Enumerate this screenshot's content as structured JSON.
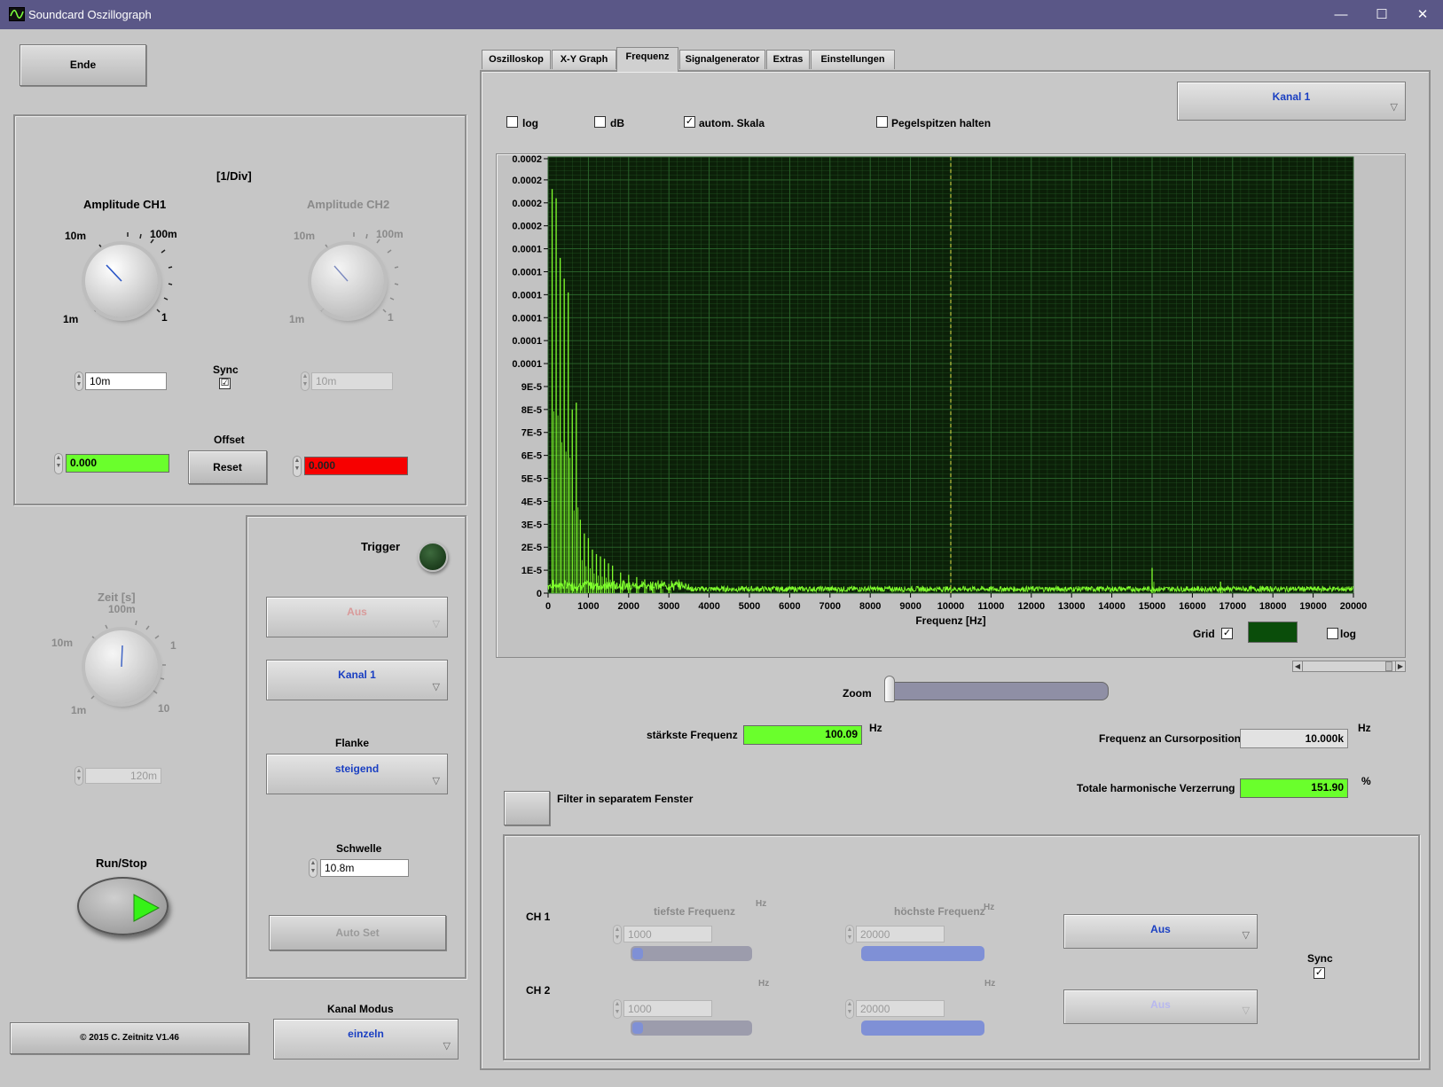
{
  "window": {
    "title": "Soundcard Oszillograph",
    "minimize": "—",
    "maximize": "☐",
    "close": "✕"
  },
  "left": {
    "ende_label": "Ende",
    "div_unit": "[1/Div]",
    "amp_ch1": {
      "label": "Amplitude CH1",
      "ticks": [
        "10m",
        "100m",
        "1m",
        "1"
      ],
      "value": "10m"
    },
    "amp_ch2": {
      "label": "Amplitude CH2",
      "ticks": [
        "10m",
        "100m",
        "1m",
        "1"
      ],
      "value": "10m"
    },
    "sync_label": "Sync",
    "sync_checked": "☑",
    "offset_label": "Offset",
    "offset_ch1": "0.000",
    "offset_reset": "Reset",
    "offset_ch2": "0.000",
    "zeit": {
      "label": "Zeit [s]",
      "ticks": [
        "100m",
        "10m",
        "1",
        "1m",
        "10"
      ],
      "value": "120m"
    },
    "runstop_label": "Run/Stop",
    "copyright": "© 2015  C. Zeitnitz V1.46",
    "kanal_modus_label": "Kanal Modus",
    "kanal_modus_value": "einzeln"
  },
  "trigger": {
    "label": "Trigger",
    "mode": "Aus",
    "channel": "Kanal 1",
    "flanke_label": "Flanke",
    "flanke_value": "steigend",
    "schwelle_label": "Schwelle",
    "schwelle_value": "10.8m",
    "autoset_label": "Auto Set"
  },
  "tabs": [
    {
      "label": "Oszilloskop"
    },
    {
      "label": "X-Y Graph"
    },
    {
      "label": "Frequenz"
    },
    {
      "label": "Signalgenerator"
    },
    {
      "label": "Extras"
    },
    {
      "label": "Einstellungen"
    }
  ],
  "freq": {
    "channel_select": "Kanal 1",
    "options": {
      "log": "log",
      "db": "dB",
      "autoscale": "autom. Skala",
      "peakhold": "Pegelspitzen halten"
    },
    "zoom_label": "Zoom",
    "strongest_label": "stärkste Frequenz",
    "strongest_value": "100.09",
    "strongest_unit": "Hz",
    "cursor_label": "Frequenz an Cursorposition",
    "cursor_value": "10.000k",
    "cursor_unit": "Hz",
    "thd_label": "Totale harmonische Verzerrung",
    "thd_value": "151.90",
    "thd_unit": "%",
    "filter_label": "Filter in separatem Fenster",
    "grid_label": "Grid",
    "log2_label": "log"
  },
  "filter": {
    "ch1": {
      "label": "CH 1",
      "low_label": "tiefste Frequenz",
      "low_unit": "Hz",
      "low_value": "1000",
      "high_label": "höchste Frequenz",
      "high_unit": "Hz",
      "high_value": "20000",
      "mode": "Aus"
    },
    "ch2": {
      "label": "CH 2",
      "low_unit": "Hz",
      "low_value": "1000",
      "high_unit": "Hz",
      "high_value": "20000",
      "mode": "Aus"
    },
    "sync_label": "Sync"
  },
  "colors": {
    "plot_bg": "#0b1f08",
    "grid": "#2f6d2f",
    "trace": "#80ff2e",
    "cursor": "#e6e64a",
    "accent": "#1a3fc2",
    "green_ind": "#6aff2c",
    "red_ind": "#f70000"
  },
  "chart_data": {
    "type": "line",
    "xlabel": "Frequenz [Hz]",
    "xlim": [
      0,
      20000
    ],
    "ylim": [
      0,
      0.00019
    ],
    "x_ticks": [
      "0",
      "1000",
      "2000",
      "3000",
      "4000",
      "5000",
      "6000",
      "7000",
      "8000",
      "9000",
      "10000",
      "11000",
      "12000",
      "13000",
      "14000",
      "15000",
      "16000",
      "17000",
      "18000",
      "19000",
      "20000"
    ],
    "y_ticks": [
      "0",
      "1E-5",
      "2E-5",
      "3E-5",
      "4E-5",
      "5E-5",
      "6E-5",
      "7E-5",
      "8E-5",
      "9E-5",
      "0.0001",
      "0.0001",
      "0.0001",
      "0.0001",
      "0.0001",
      "0.0001",
      "0.0002",
      "0.0002",
      "0.0002",
      "0.0002"
    ],
    "cursor_x": 10000,
    "peaks": [
      {
        "x": 100,
        "y": 0.000176
      },
      {
        "x": 200,
        "y": 0.000172
      },
      {
        "x": 300,
        "y": 0.000146
      },
      {
        "x": 400,
        "y": 0.000137
      },
      {
        "x": 500,
        "y": 0.000131
      },
      {
        "x": 600,
        "y": 8e-05
      },
      {
        "x": 700,
        "y": 8.3e-05
      },
      {
        "x": 800,
        "y": 3.2e-05
      },
      {
        "x": 900,
        "y": 2.6e-05
      },
      {
        "x": 1000,
        "y": 2.4e-05
      },
      {
        "x": 1100,
        "y": 1.9e-05
      },
      {
        "x": 1200,
        "y": 1.7e-05
      },
      {
        "x": 1300,
        "y": 1.6e-05
      },
      {
        "x": 1400,
        "y": 1.5e-05
      },
      {
        "x": 1500,
        "y": 1.3e-05
      },
      {
        "x": 1600,
        "y": 1.2e-05
      },
      {
        "x": 1800,
        "y": 9e-06
      },
      {
        "x": 2000,
        "y": 8e-06
      },
      {
        "x": 2200,
        "y": 7e-06
      },
      {
        "x": 2400,
        "y": 6e-06
      },
      {
        "x": 2600,
        "y": 5e-06
      },
      {
        "x": 2800,
        "y": 4e-06
      },
      {
        "x": 3000,
        "y": 4e-06
      },
      {
        "x": 15000,
        "y": 1.1e-05
      },
      {
        "x": 16700,
        "y": 5e-06
      }
    ],
    "noise_floor": 2e-06,
    "grid": true
  }
}
